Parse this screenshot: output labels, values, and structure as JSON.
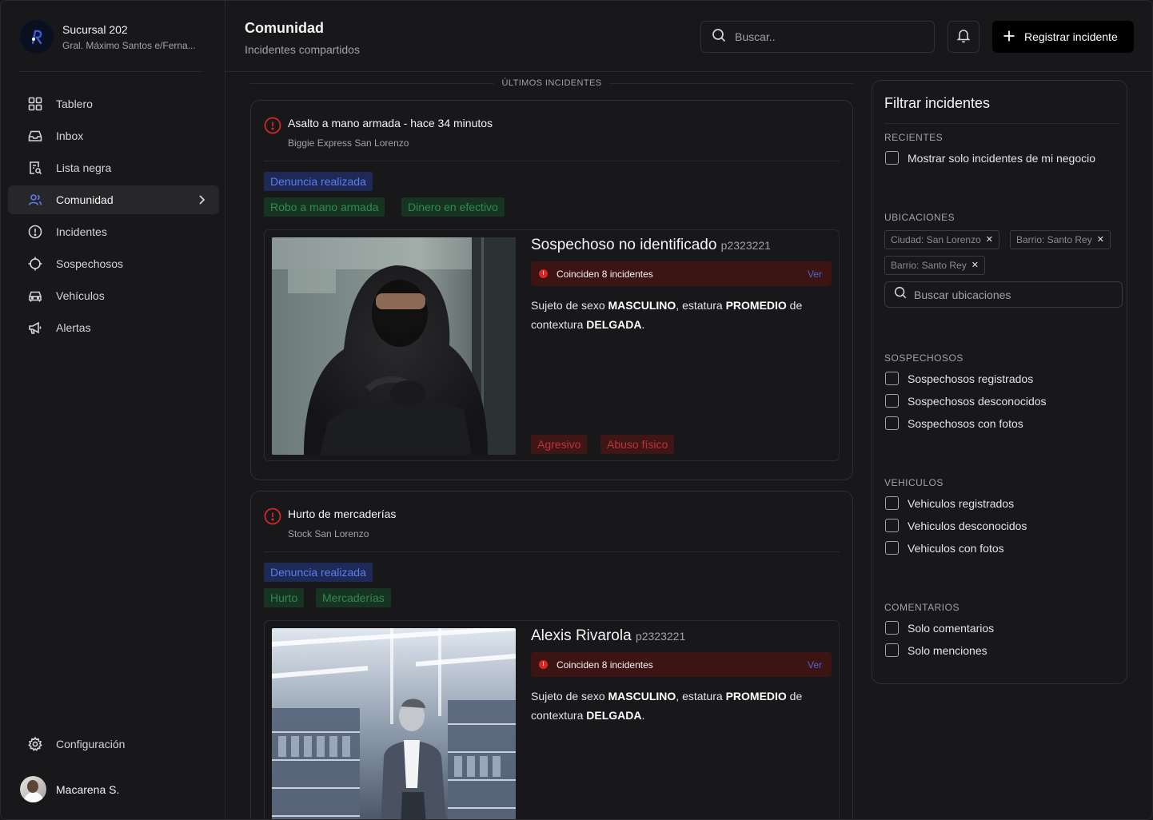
{
  "brand": {
    "name": "Sucursal 202",
    "address": "Gral. Máximo Santos e/Ferna..."
  },
  "nav": [
    {
      "label": "Tablero",
      "icon": "grid-icon"
    },
    {
      "label": "Inbox",
      "icon": "inbox-icon"
    },
    {
      "label": "Lista negra",
      "icon": "blacklist-icon"
    },
    {
      "label": "Comunidad",
      "icon": "users-icon",
      "active": true
    },
    {
      "label": "Incidentes",
      "icon": "alert-circle-icon"
    },
    {
      "label": "Sospechosos",
      "icon": "crosshair-icon"
    },
    {
      "label": "Vehículos",
      "icon": "car-icon"
    },
    {
      "label": "Alertas",
      "icon": "megaphone-icon"
    }
  ],
  "settings_label": "Configuración",
  "user": {
    "name": "Macarena S."
  },
  "header": {
    "title": "Comunidad",
    "subtitle": "Incidentes compartidos",
    "search_placeholder": "Buscar..",
    "cta_label": "Registrar incidente"
  },
  "feed": {
    "section_label": "ÚLTIMOS INCIDENTES",
    "incidents": [
      {
        "title": "Asalto a mano armada - hace 34 minutos",
        "location": "Biggie Express San Lorenzo",
        "status_tag": "Denuncia realizada",
        "tags": [
          "Robo a mano armada",
          "Dinero en efectivo"
        ],
        "suspect": {
          "name": "Sospechoso no identificado",
          "code": "p2323221",
          "match_text": "Coinciden 8 incidentes",
          "match_link": "Ver",
          "desc_1": "Sujeto de sexo ",
          "sex": "MASCULINO",
          "desc_2": ", estatura ",
          "height": "PROMEDIO",
          "desc_3": " de contextura ",
          "build": "DELGADA",
          "desc_4": ".",
          "traits": [
            "Agresivo",
            "Abuso físico"
          ]
        }
      },
      {
        "title": "Hurto de mercaderías",
        "location": "Stock San Lorenzo",
        "status_tag": "Denuncia realizada",
        "tags": [
          "Hurto",
          "Mercaderías"
        ],
        "suspect": {
          "name": "Alexis Rivarola",
          "code": "p2323221",
          "match_text": "Coinciden 8 incidentes",
          "match_link": "Ver",
          "desc_1": "Sujeto de sexo ",
          "sex": "MASCULINO",
          "desc_2": ", estatura ",
          "height": "PROMEDIO",
          "desc_3": " de contextura ",
          "build": "DELGADA",
          "desc_4": "."
        }
      }
    ]
  },
  "filters": {
    "title": "Filtrar incidentes",
    "recent_label": "RECIENTES",
    "recent_option": "Mostrar solo incidentes de mi negocio",
    "locations_label": "UBICACIONES",
    "location_chips": [
      "Ciudad: San Lorenzo",
      "Barrio: Santo Rey",
      "Barrio: Santo Rey"
    ],
    "location_search_placeholder": "Buscar ubicaciones",
    "suspects_label": "SOSPECHOSOS",
    "suspect_options": [
      "Sospechosos registrados",
      "Sospechosos desconocidos",
      "Sospechosos con fotos"
    ],
    "vehicles_label": "VEHICULOS",
    "vehicle_options": [
      "Vehiculos registrados",
      "Vehiculos desconocidos",
      "Vehiculos con fotos"
    ],
    "comments_label": "COMENTARIOS",
    "comment_options": [
      "Solo comentarios",
      "Solo menciones"
    ]
  },
  "colors": {
    "accent_blue": "#5b7cf0",
    "danger": "#dc2626",
    "success": "#2f8a55"
  }
}
